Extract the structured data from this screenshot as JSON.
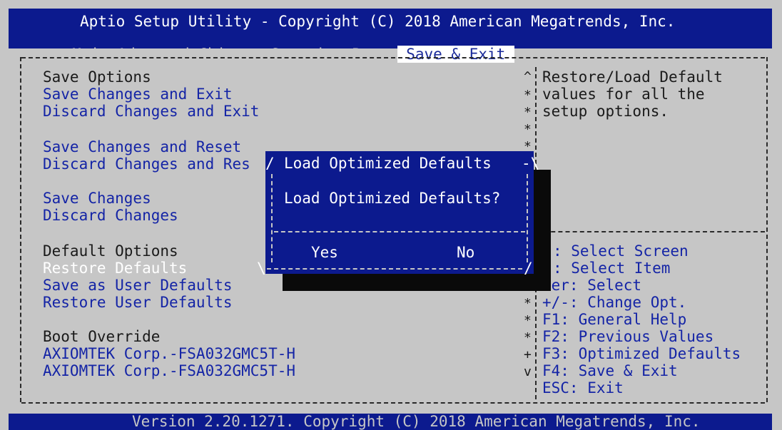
{
  "header": {
    "title": "Aptio Setup Utility - Copyright (C) 2018 American Megatrends, Inc.",
    "tabs": [
      {
        "label": "Main"
      },
      {
        "label": "Advanced"
      },
      {
        "label": "Chipset"
      },
      {
        "label": "Security"
      },
      {
        "label": "Boot"
      },
      {
        "label": "Save & Exit",
        "active": true
      }
    ]
  },
  "left": {
    "save_options": {
      "heading": "Save Options",
      "items": [
        "Save Changes and Exit",
        "Discard Changes and Exit",
        "Save Changes and Reset",
        "Discard Changes and Res"
      ]
    },
    "save": {
      "items": [
        "Save Changes",
        "Discard Changes"
      ]
    },
    "default_options": {
      "heading": "Default Options",
      "items": [
        "Restore Defaults",
        "Save as User Defaults",
        "Restore User Defaults"
      ]
    },
    "boot_override": {
      "heading": "Boot Override",
      "items": [
        "AXIOMTEK Corp.-FSA032GMC5T-H",
        "AXIOMTEK Corp.-FSA032GMC5T-H"
      ]
    }
  },
  "help": {
    "lines": [
      "Restore/Load Default",
      "values for all the",
      "setup options."
    ]
  },
  "keys": {
    "lines": [
      ": Select Screen",
      ": Select Item",
      "ter: Select",
      "+/-: Change Opt.",
      "F1: General Help",
      "F2: Previous Values",
      "F3: Optimized Defaults",
      "F4: Save & Exit",
      "ESC: Exit"
    ]
  },
  "scrollbar": {
    "marks": [
      "^",
      "*",
      "*",
      "*",
      "*",
      "*",
      "*",
      "*",
      "*",
      "*",
      "+",
      "v"
    ]
  },
  "dialog": {
    "title": "Load Optimized Defaults",
    "question": "Load Optimized Defaults?",
    "yes": "Yes",
    "no": "No"
  },
  "footer": {
    "text": "Version 2.20.1271. Copyright (C) 2018 American Megatrends, Inc."
  },
  "colors": {
    "header_bg": "#0c1a8e",
    "body_bg": "#c6c6c6",
    "item_blue": "#1424a6",
    "selected_white": "#ffffff"
  }
}
